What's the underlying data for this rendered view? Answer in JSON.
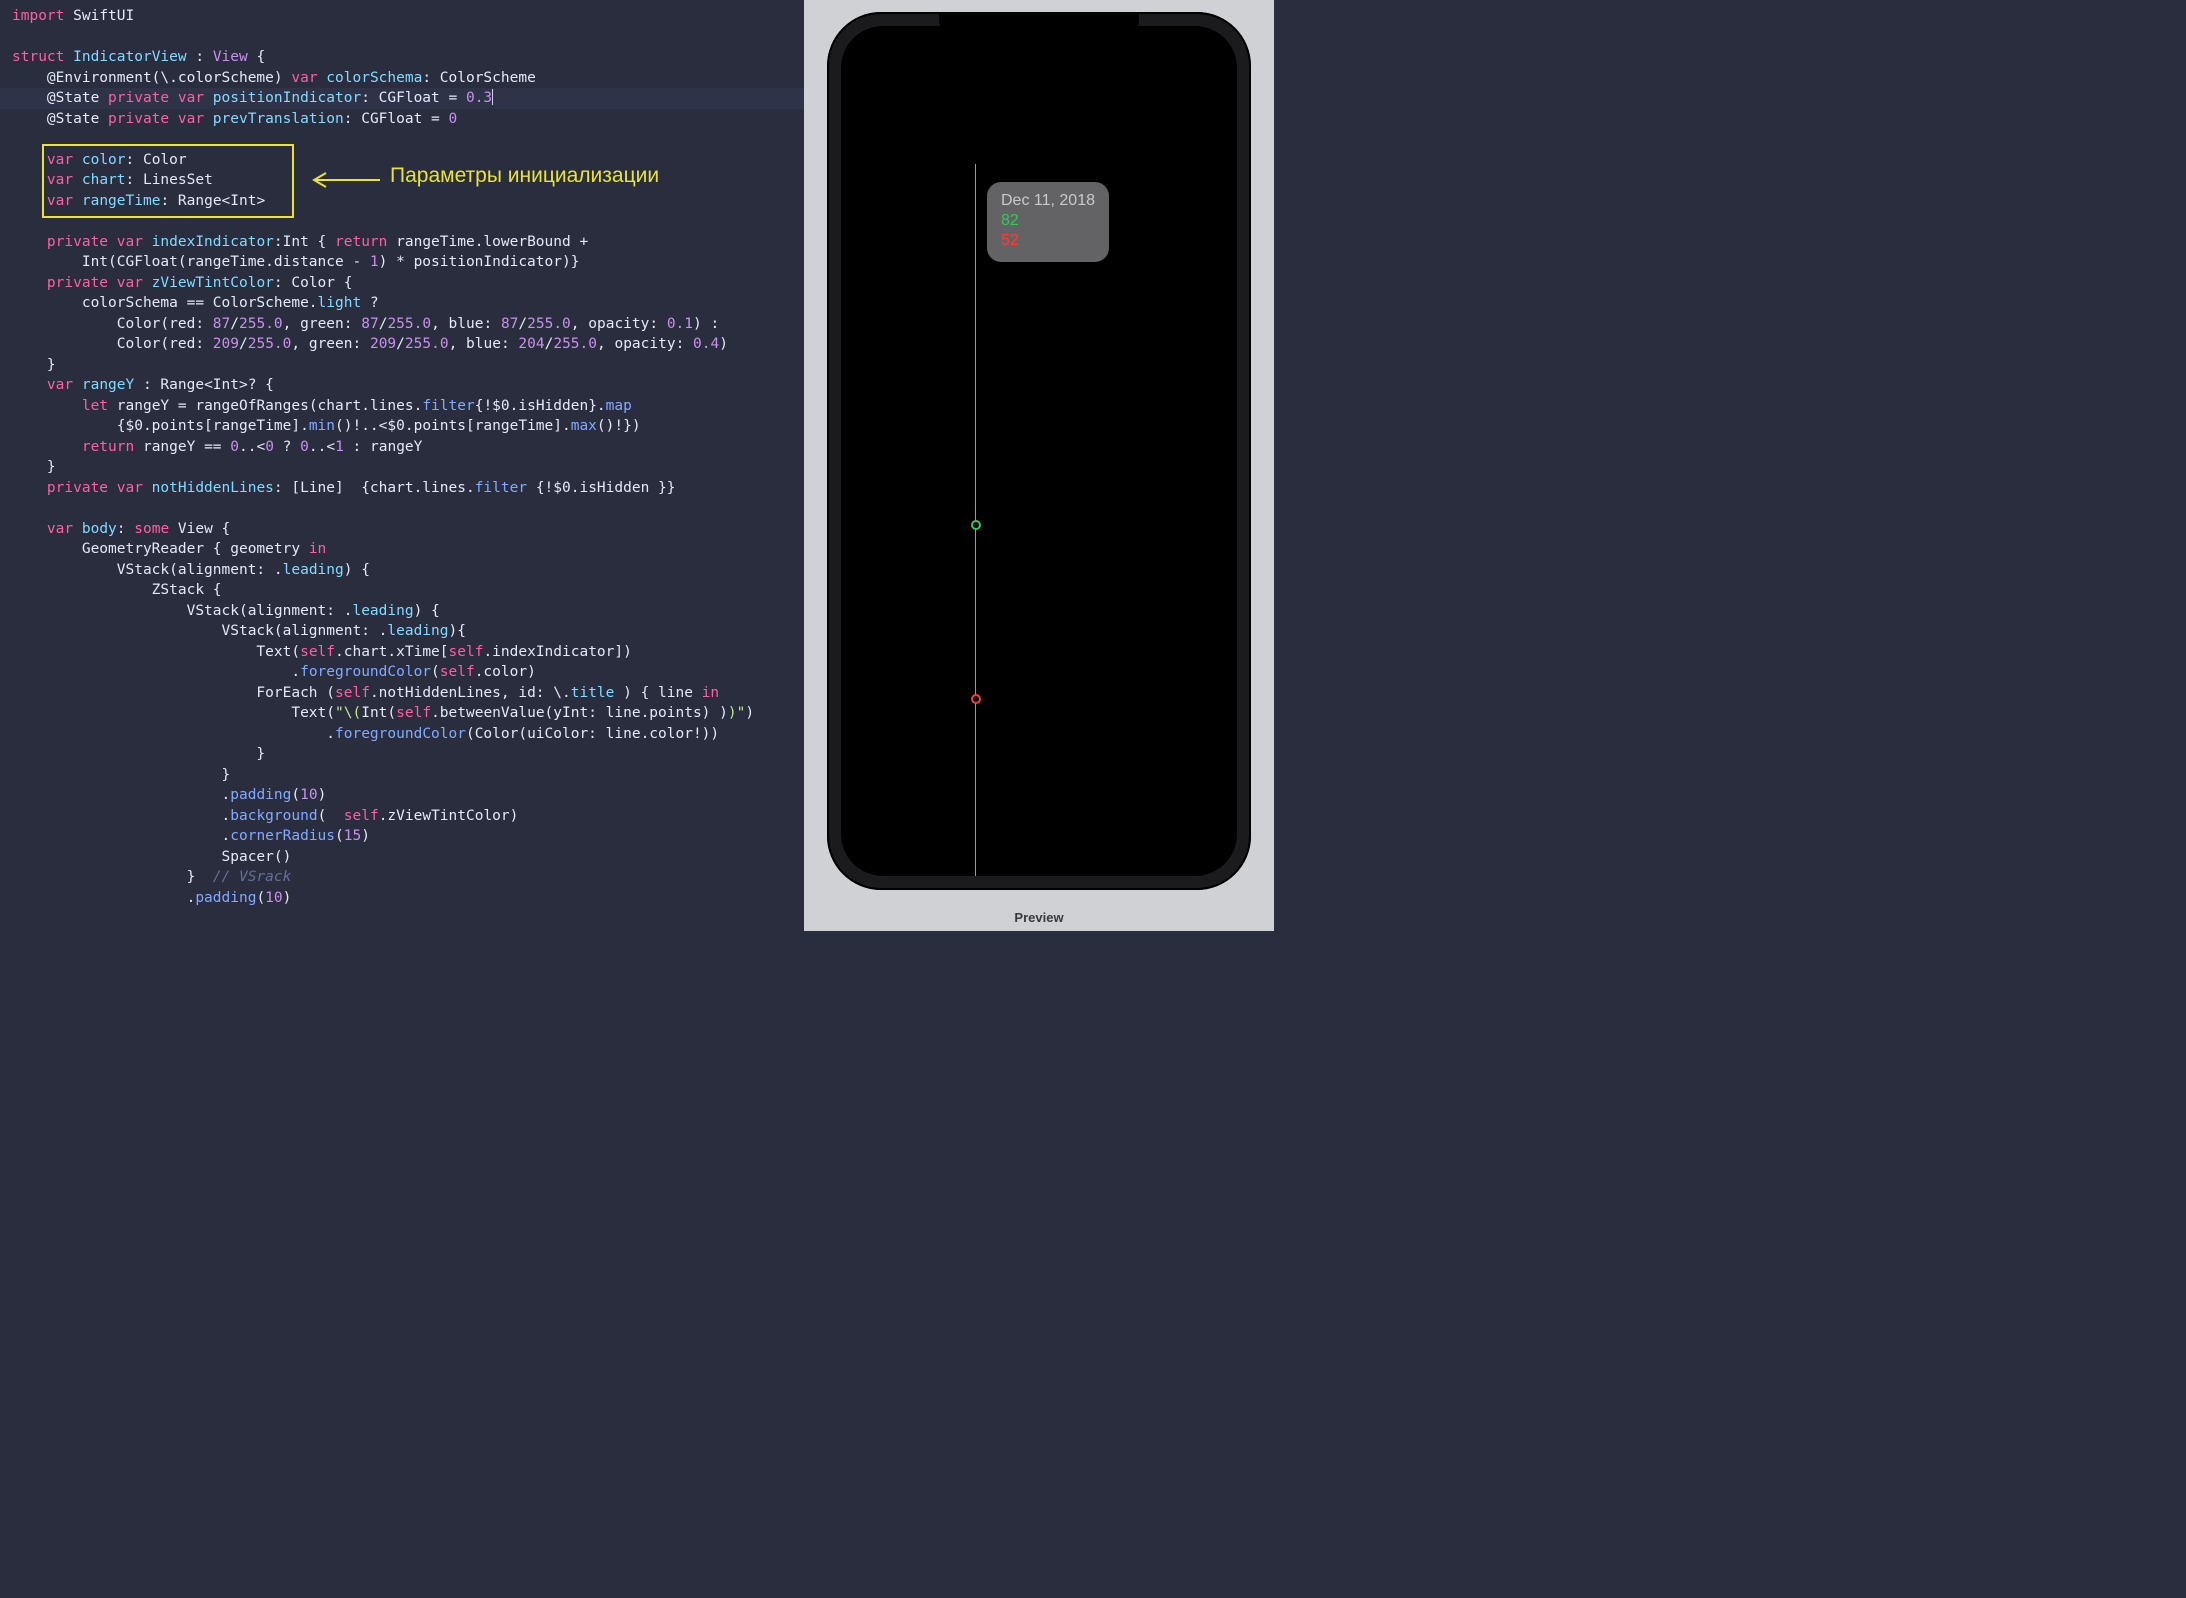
{
  "callout": {
    "label": "Параметры инициализации"
  },
  "tooltip": {
    "date": "Dec 11, 2018",
    "v1": "82",
    "v2": "52"
  },
  "preview_label": "Preview",
  "code": {
    "l1_import": "import",
    "l1_mod": "SwiftUI",
    "l3_struct": "struct",
    "l3_name": "IndicatorView",
    "l3_colon": " : ",
    "l3_proto": "View",
    "l3_brace": " {",
    "l4": "    @Environment(\\.colorScheme) ",
    "l4_var": "var",
    "l4_name": " colorSchema",
    "l4_rest": ": ColorScheme",
    "l5": "    @State ",
    "l5_priv": "private",
    "l5_var": " var",
    "l5_name": " positionIndicator",
    "l5_rest": ": CGFloat = ",
    "l5_val": "0.3",
    "l6": "    @State ",
    "l6_priv": "private",
    "l6_var": " var",
    "l6_name": " prevTranslation",
    "l6_rest": ": CGFloat = ",
    "l6_val": "0",
    "l8_var": "var",
    "l8_name": " color",
    "l8_rest": ": Color",
    "l9_var": "var",
    "l9_name": " chart",
    "l9_rest": ": LinesSet",
    "l10_var": "var",
    "l10_name": " rangeTime",
    "l10_rest": ": Range<Int>",
    "l12": "    ",
    "l12_priv": "private",
    "l12_var": " var",
    "l12_name": " indexIndicator",
    "l12_type": ":Int { ",
    "l12_ret": "return",
    "l12_rest": " rangeTime.lowerBound +",
    "l13": "        Int(CGFloat(rangeTime.distance - ",
    "l13_one": "1",
    "l13_rest": ") * positionIndicator)}",
    "l14": "    ",
    "l14_priv": "private",
    "l14_var": " var",
    "l14_name": " zViewTintColor",
    "l14_rest": ": Color {",
    "l15": "        colorSchema == ColorScheme.",
    "l15_prop": "light",
    "l15_q": " ?",
    "l16": "            Color(red: ",
    "l16_a": "87",
    "l16_b": "/",
    "l16_c": "255.0",
    "l16_d": ", green: ",
    "l16_e": "87",
    "l16_f": "/",
    "l16_g": "255.0",
    "l16_h": ", blue: ",
    "l16_i": "87",
    "l16_j": "/",
    "l16_k": "255.0",
    "l16_l": ", opacity: ",
    "l16_m": "0.1",
    "l16_n": ") :",
    "l17": "            Color(red: ",
    "l17_a": "209",
    "l17_b": "/",
    "l17_c": "255.0",
    "l17_d": ", green: ",
    "l17_e": "209",
    "l17_f": "/",
    "l17_g": "255.0",
    "l17_h": ", blue: ",
    "l17_i": "204",
    "l17_j": "/",
    "l17_k": "255.0",
    "l17_l": ", opacity: ",
    "l17_m": "0.4",
    "l17_n": ")",
    "l18": "    }",
    "l19_var": "var",
    "l19_name": " rangeY ",
    "l19_rest": ": Range<Int>? {",
    "l20": "        ",
    "l20_let": "let",
    "l20_rest": " rangeY = rangeOfRanges(chart.lines.",
    "l20_m1": "filter",
    "l20_a": "{!$0.isHidden}.",
    "l20_m2": "map",
    "l21": "            {$0.points[rangeTime].",
    "l21_m1": "min",
    "l21_a": "()!..<$0.points[rangeTime].",
    "l21_m2": "max",
    "l21_b": "()!})",
    "l22": "        ",
    "l22_ret": "return",
    "l22_rest": " rangeY == ",
    "l22_a": "0",
    "l22_b": "..<",
    "l22_c": "0",
    "l22_d": " ? ",
    "l22_e": "0",
    "l22_f": "..<",
    "l22_g": "1",
    "l22_h": " : rangeY",
    "l23": "    }",
    "l24": "    ",
    "l24_priv": "private",
    "l24_var": " var",
    "l24_name": " notHiddenLines",
    "l24_rest": ": [Line]  {chart.lines.",
    "l24_m": "filter",
    "l24_end": " {!$0.isHidden }}",
    "l26_var": "var",
    "l26_name": " body",
    "l26_rest": ": ",
    "l26_some": "some",
    "l26_view": " View {",
    "l27": "        GeometryReader { geometry ",
    "l27_in": "in",
    "l28": "            VStack(alignment: .",
    "l28_p": "leading",
    "l28_e": ") {",
    "l29": "                ZStack {",
    "l30": "                    VStack(alignment: .",
    "l30_p": "leading",
    "l30_e": ") {",
    "l31": "                        VStack(alignment: .",
    "l31_p": "leading",
    "l31_e": "){",
    "l32": "                            Text(",
    "l32_s": "self",
    "l32_a": ".chart.xTime[",
    "l32_s2": "self",
    "l32_b": ".indexIndicator])",
    "l33": "                                .",
    "l33_m": "foregroundColor",
    "l33_a": "(",
    "l33_s": "self",
    "l33_b": ".color)",
    "l34": "                            ForEach (",
    "l34_s": "self",
    "l34_a": ".notHiddenLines, id: \\.",
    "l34_p": "title",
    "l34_b": " ) { line ",
    "l34_in": "in",
    "l35_a": "                                Text(",
    "l35_str1": "\"\\(",
    "l35_b": "Int(",
    "l35_s": "self",
    "l35_c": ".betweenValue(yInt: line.points) )",
    "l35_str2": ")\"",
    "l35_d": ")",
    "l36": "                                    .",
    "l36_m": "foregroundColor",
    "l36_a": "(Color(uiColor: line.color!))",
    "l37": "                            }",
    "l38": "                        }",
    "l39": "                        .",
    "l39_m": "padding",
    "l39_a": "(",
    "l39_v": "10",
    "l39_b": ")",
    "l40": "                        .",
    "l40_m": "background",
    "l40_a": "(  ",
    "l40_s": "self",
    "l40_b": ".zViewTintColor)",
    "l41": "                        .",
    "l41_m": "cornerRadius",
    "l41_a": "(",
    "l41_v": "15",
    "l41_b": ")",
    "l42": "                        Spacer()",
    "l43": "                    }  ",
    "l43_c": "// VSrack",
    "l44": "                    .",
    "l44_m": "padding",
    "l44_a": "(",
    "l44_v": "10",
    "l44_b": ")"
  }
}
